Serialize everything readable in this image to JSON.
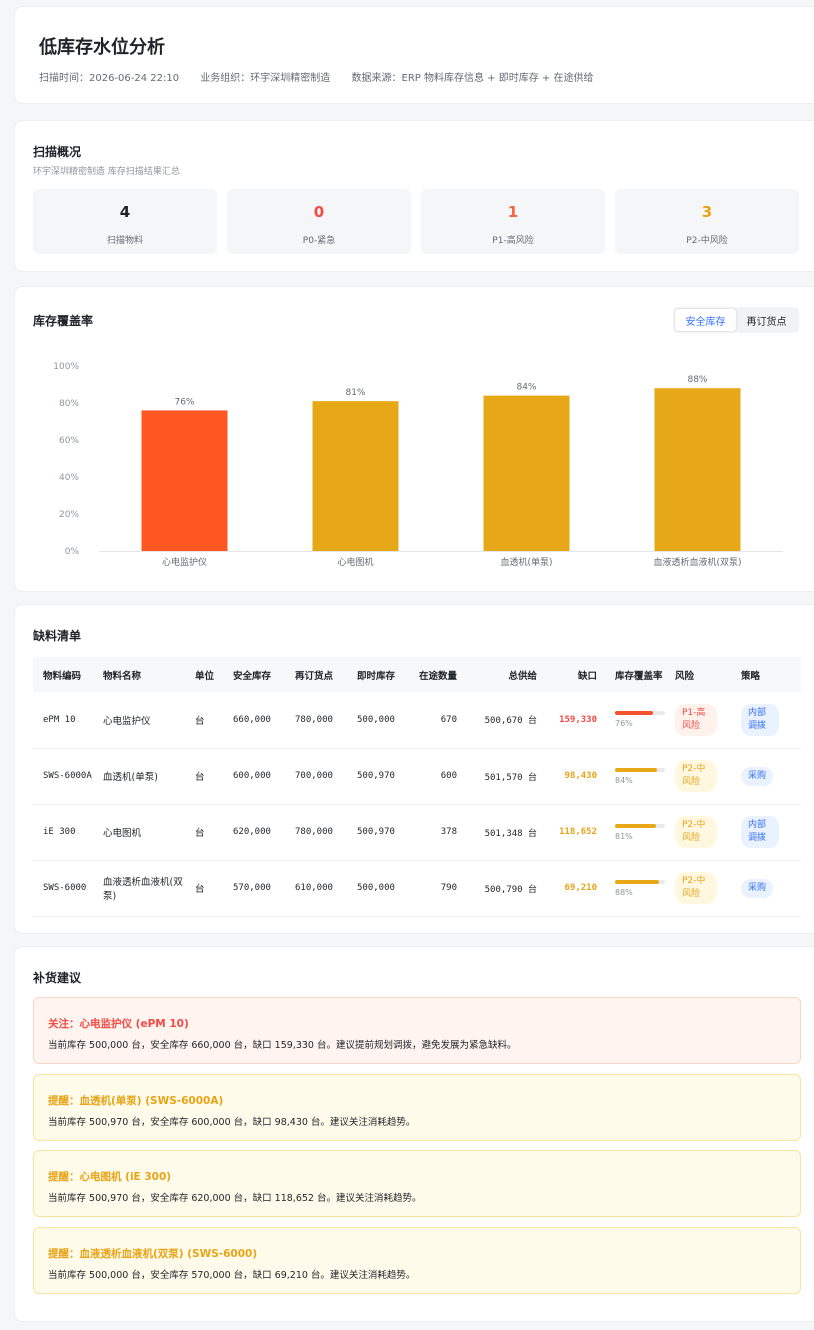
{
  "header": {
    "title": "低库存水位分析",
    "scan_time": "扫描时间：2026-06-24 22:10",
    "org": "业务组织：环宇深圳精密制造",
    "source": "数据来源：ERP 物料库存信息 + 即时库存 + 在途供给"
  },
  "overview": {
    "title": "扫描概况",
    "subtitle": "环宇深圳精密制造 库存扫描结果汇总",
    "stats": [
      {
        "value": "4",
        "label": "扫描物料",
        "color": "#1f2329"
      },
      {
        "value": "0",
        "label": "P0-紧急",
        "color": "#f54a45"
      },
      {
        "value": "1",
        "label": "P1-高风险",
        "color": "#f5663c"
      },
      {
        "value": "3",
        "label": "P2-中风险",
        "color": "#e8a317"
      }
    ]
  },
  "coverage": {
    "title": "库存覆盖率",
    "tabs": [
      "安全库存",
      "再订货点"
    ],
    "active_tab": 0
  },
  "chart_data": {
    "type": "bar",
    "categories": [
      "心电监护仪",
      "心电图机",
      "血透机(单泵)",
      "血液透析血液机(双泵)"
    ],
    "values": [
      76,
      81,
      84,
      88
    ],
    "data_labels": [
      "76%",
      "81%",
      "84%",
      "88%"
    ],
    "colors": [
      "#ff5722",
      "#e6a817",
      "#e6a817",
      "#e6a817"
    ],
    "ylim": [
      0,
      100
    ],
    "yticks": [
      "0%",
      "20%",
      "40%",
      "60%",
      "80%",
      "100%"
    ],
    "grid": false
  },
  "shortage": {
    "title": "缺料清单",
    "columns": [
      "物料编码",
      "物料名称",
      "单位",
      "安全库存",
      "再订货点",
      "即时库存",
      "在途数量",
      "总供给",
      "缺口",
      "库存覆盖率",
      "风险",
      "策略"
    ],
    "rows": [
      {
        "code": "ePM 10",
        "name": "心电监护仪",
        "unit": "台",
        "safety": "660,000",
        "reorder": "780,000",
        "onhand": "500,000",
        "transit": "670",
        "supply": "500,670 台",
        "gap": "159,330",
        "coverage": 76,
        "coverage_label": "76%",
        "risk": "P1-高风险",
        "risk_level": "p1",
        "strategy": "内部调拨"
      },
      {
        "code": "SWS-6000A",
        "name": "血透机(单泵)",
        "unit": "台",
        "safety": "600,000",
        "reorder": "700,000",
        "onhand": "500,970",
        "transit": "600",
        "supply": "501,570 台",
        "gap": "98,430",
        "coverage": 84,
        "coverage_label": "84%",
        "risk": "P2-中风险",
        "risk_level": "p2",
        "strategy": "采购"
      },
      {
        "code": "iE 300",
        "name": "心电图机",
        "unit": "台",
        "safety": "620,000",
        "reorder": "780,000",
        "onhand": "500,970",
        "transit": "378",
        "supply": "501,348 台",
        "gap": "118,652",
        "coverage": 81,
        "coverage_label": "81%",
        "risk": "P2-中风险",
        "risk_level": "p2",
        "strategy": "内部调拨"
      },
      {
        "code": "SWS-6000",
        "name": "血液透析血液机(双泵)",
        "unit": "台",
        "safety": "570,000",
        "reorder": "610,000",
        "onhand": "500,000",
        "transit": "790",
        "supply": "500,790 台",
        "gap": "69,210",
        "coverage": 88,
        "coverage_label": "88%",
        "risk": "P2-中风险",
        "risk_level": "p2",
        "strategy": "采购"
      }
    ]
  },
  "suggestions": {
    "title": "补货建议",
    "items": [
      {
        "title": "关注：心电监护仪 (ePM 10)",
        "desc": "当前库存 500,000 台，安全库存 660,000 台，缺口 159,330 台。建议提前规划调拨，避免发展为紧急缺料。",
        "level": "red"
      },
      {
        "title": "提醒：血透机(单泵) (SWS-6000A)",
        "desc": "当前库存 500,970 台，安全库存 600,000 台，缺口 98,430 台。建议关注消耗趋势。",
        "level": "yel"
      },
      {
        "title": "提醒：心电图机 (iE 300)",
        "desc": "当前库存 500,970 台，安全库存 620,000 台，缺口 118,652 台。建议关注消耗趋势。",
        "level": "yel"
      },
      {
        "title": "提醒：血液透析血液机(双泵) (SWS-6000)",
        "desc": "当前库存 500,000 台，安全库存 570,000 台，缺口 69,210 台。建议关注消耗趋势。",
        "level": "yel"
      }
    ]
  }
}
